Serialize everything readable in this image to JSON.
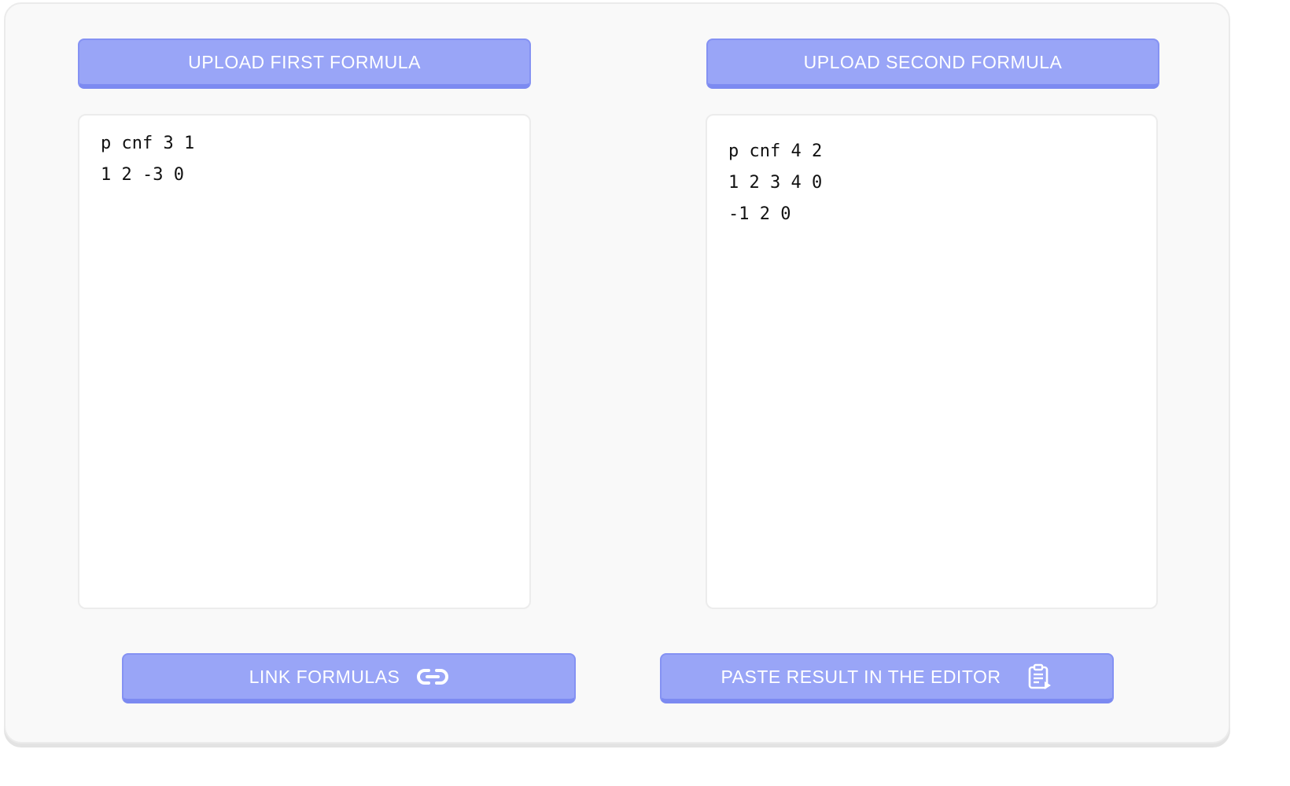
{
  "left": {
    "upload_label": "UPLOAD FIRST FORMULA",
    "editor_lines": [
      "p cnf 3 1",
      "1 2 -3 0"
    ]
  },
  "right": {
    "upload_label": "UPLOAD SECOND FORMULA",
    "editor_lines": [
      "p cnf 4 2",
      "1 2 3 4 0",
      "-1 2 0"
    ]
  },
  "actions": {
    "link_label": "LINK FORMULAS",
    "link_icon": "link-icon",
    "paste_label": "PASTE RESULT IN THE EDITOR",
    "paste_icon": "clipboard-paste-icon"
  },
  "colors": {
    "button_bg": "#99a5f7",
    "button_border": "#7c8af1",
    "panel_bg": "#f9f9f9",
    "editor_bg": "#ffffff"
  }
}
